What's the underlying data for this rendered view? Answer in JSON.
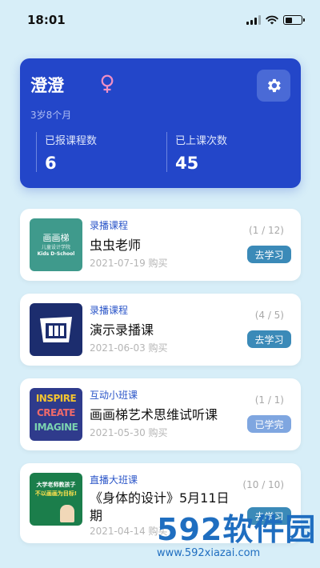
{
  "status": {
    "time": "18:01"
  },
  "profile": {
    "name": "澄澄",
    "age": "3岁8个月",
    "stats": [
      {
        "label": "已报课程数",
        "value": "6"
      },
      {
        "label": "已上课次数",
        "value": "45"
      }
    ]
  },
  "courses": [
    {
      "type": "录播课程",
      "title": "虫虫老师",
      "date": "2021-07-19 购买",
      "progress": "(1 / 12)",
      "action": "去学习",
      "thumb_lines": [
        "画画梯",
        "儿童设计学院",
        "Kids D-School"
      ]
    },
    {
      "type": "录播课程",
      "title": "演示录播课",
      "date": "2021-06-03 购买",
      "progress": "(4 / 5)",
      "action": "去学习"
    },
    {
      "type": "互动小班课",
      "title": "画画梯艺术思维试听课",
      "date": "2021-05-30 购买",
      "progress": "(1 / 1)",
      "action": "已学完",
      "thumb_lines": [
        "INSPIRE",
        "CREATE",
        "IMAGINE"
      ]
    },
    {
      "type": "直播大班课",
      "title_line1": "《身体的设计》5月11日",
      "title_line2": "期",
      "date": "2021-04-14 购买",
      "progress": "(10 / 10)",
      "action": "去学习",
      "thumb_lines": [
        "大学老师教孩子",
        "不以画画为目标!"
      ]
    }
  ],
  "watermark": {
    "big": "592软件园",
    "small": "www.592xiazai.com"
  },
  "colors": {
    "primary": "#2346c9",
    "accent_button": "#3b8ab8",
    "background": "#d7eef8"
  }
}
